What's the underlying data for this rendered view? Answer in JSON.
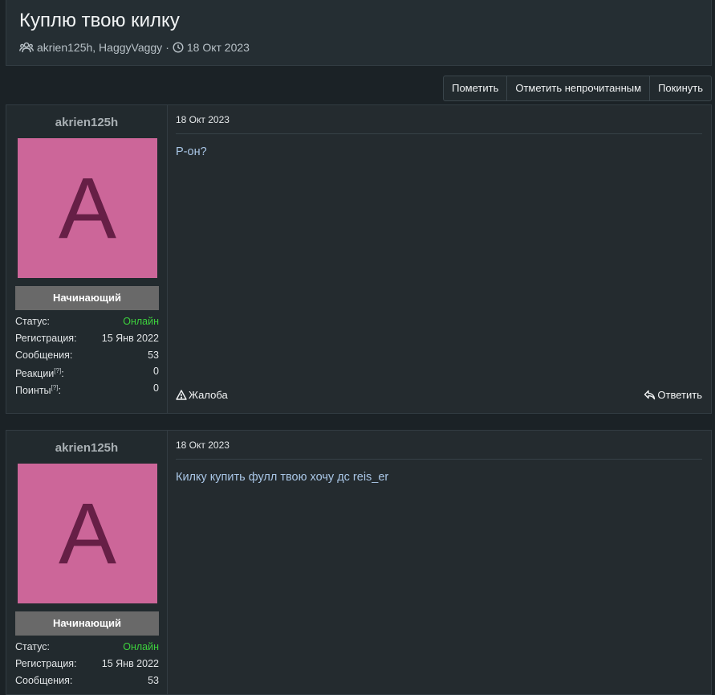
{
  "thread": {
    "title": "Куплю твою килку",
    "participants": "akrien125h, HaggyVaggy",
    "separator": "·",
    "date": "18 Окт 2023"
  },
  "toolbar": {
    "mark_label": "Пометить",
    "mark_unread_label": "Отметить непрочитанным",
    "leave_label": "Покинуть"
  },
  "labels": {
    "status": "Статус:",
    "registration": "Регистрация:",
    "messages": "Сообщения:",
    "reactions": "Реакции",
    "points": "Поинты",
    "help_mark": "[?]",
    "colon": ":",
    "report": "Жалоба",
    "reply": "Ответить"
  },
  "posts": [
    {
      "username": "akrien125h",
      "avatar_letter": "A",
      "rank": "Начинающий",
      "status": "Онлайн",
      "registered": "15 Янв 2022",
      "messages": "53",
      "reactions": "0",
      "points": "0",
      "date": "18 Окт 2023",
      "text": "Р-он?"
    },
    {
      "username": "akrien125h",
      "avatar_letter": "A",
      "rank": "Начинающий",
      "status": "Онлайн",
      "registered": "15 Янв 2022",
      "messages": "53",
      "date": "18 Окт 2023",
      "text": "Килку купить фулл твою хочу дс reis_er"
    }
  ],
  "colors": {
    "avatar_bg": "#cc6699",
    "online": "#3dd13d",
    "rank_bg": "#696969"
  },
  "icons": [
    "users-icon",
    "clock-icon",
    "warning-icon",
    "reply-icon"
  ]
}
